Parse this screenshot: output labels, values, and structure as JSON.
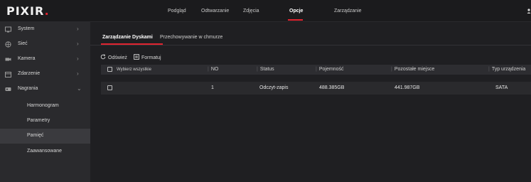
{
  "logo": {
    "text": "PIXIR",
    "accent": "."
  },
  "nav": {
    "items": [
      "Podgląd",
      "Odtwarzanie",
      "Zdjęcia",
      "Opcje",
      "Zarządzanie"
    ],
    "active_index": 3
  },
  "sidebar": {
    "items": [
      {
        "label": "System",
        "icon": "system-icon"
      },
      {
        "label": "Sieć",
        "icon": "network-icon"
      },
      {
        "label": "Kamera",
        "icon": "camera-icon"
      },
      {
        "label": "Zdarzenie",
        "icon": "event-icon"
      },
      {
        "label": "Nagrania",
        "icon": "recording-icon"
      }
    ],
    "subitems": [
      "Harmonogram",
      "Parametry",
      "Pamięć",
      "Zaawansowane"
    ],
    "selected_subitem": "Pamięć"
  },
  "tabs": [
    "Zarządzanie Dyskami",
    "Przechowywanie w chmurze"
  ],
  "active_tab": 0,
  "toolbar": {
    "refresh_label": "Odśwież",
    "format_label": "Formatuj"
  },
  "table": {
    "columns": [
      "Wybierz wszystkie",
      "NO",
      "Status",
      "Pojemność",
      "Pozostałe miejsce",
      "Typ urządzenia"
    ],
    "rows": [
      {
        "no": "1",
        "status": "Odczyt-zapis",
        "capacity": "488.385GB",
        "free": "441.987GB",
        "type": "SATA"
      }
    ]
  },
  "colors": {
    "accent": "#e02430",
    "sidebar_bg": "#2a2a2d",
    "content_bg": "#1f1f22"
  }
}
